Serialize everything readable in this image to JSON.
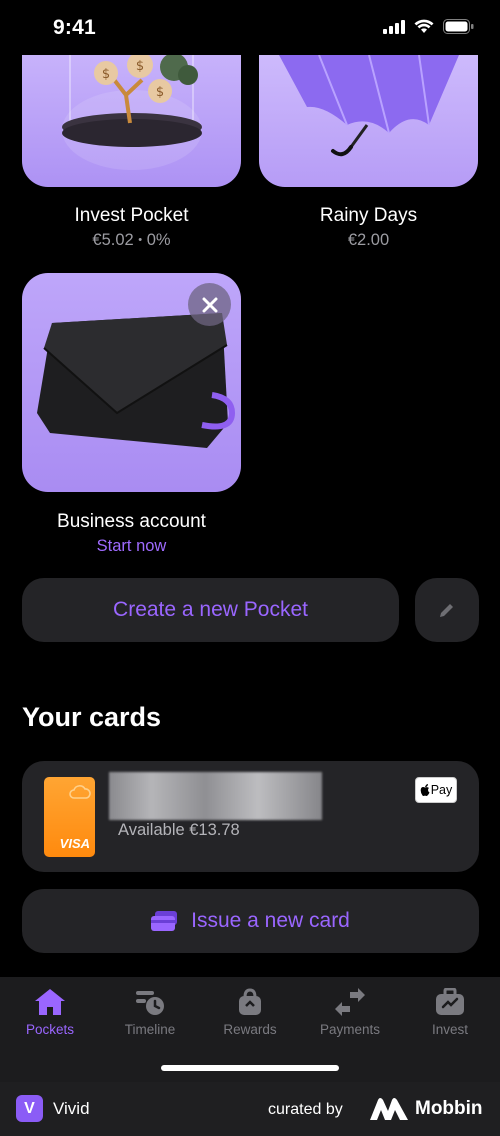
{
  "status_bar": {
    "time": "9:41"
  },
  "pockets": [
    {
      "name": "Invest Pocket",
      "amount": "€5.02",
      "separator": "•",
      "percent": "0%"
    },
    {
      "name": "Rainy Days",
      "amount": "€2.00"
    },
    {
      "name": "Business account",
      "link": "Start now"
    }
  ],
  "actions": {
    "create_pocket": "Create a new Pocket"
  },
  "cards_section": {
    "title": "Your cards",
    "card": {
      "brand": "VISA",
      "available": "Available €13.78",
      "wallet_badge": "Pay"
    },
    "issue_card": "Issue a new card"
  },
  "tabbar": {
    "tabs": [
      {
        "label": "Pockets",
        "icon": "home-icon",
        "active": true
      },
      {
        "label": "Timeline",
        "icon": "timeline-icon"
      },
      {
        "label": "Rewards",
        "icon": "rewards-bag-icon"
      },
      {
        "label": "Payments",
        "icon": "transfer-arrows-icon"
      },
      {
        "label": "Invest",
        "icon": "invest-briefcase-icon"
      }
    ]
  },
  "footer": {
    "app_logo_letter": "V",
    "app_name": "Vivid",
    "curated_by": "curated by",
    "brand": "Mobbin"
  },
  "colors": {
    "accent": "#9a66ff",
    "background": "#000000",
    "surface": "#242427",
    "card_orange": "#ff9520",
    "tile_lilac": "#b99ef7"
  }
}
